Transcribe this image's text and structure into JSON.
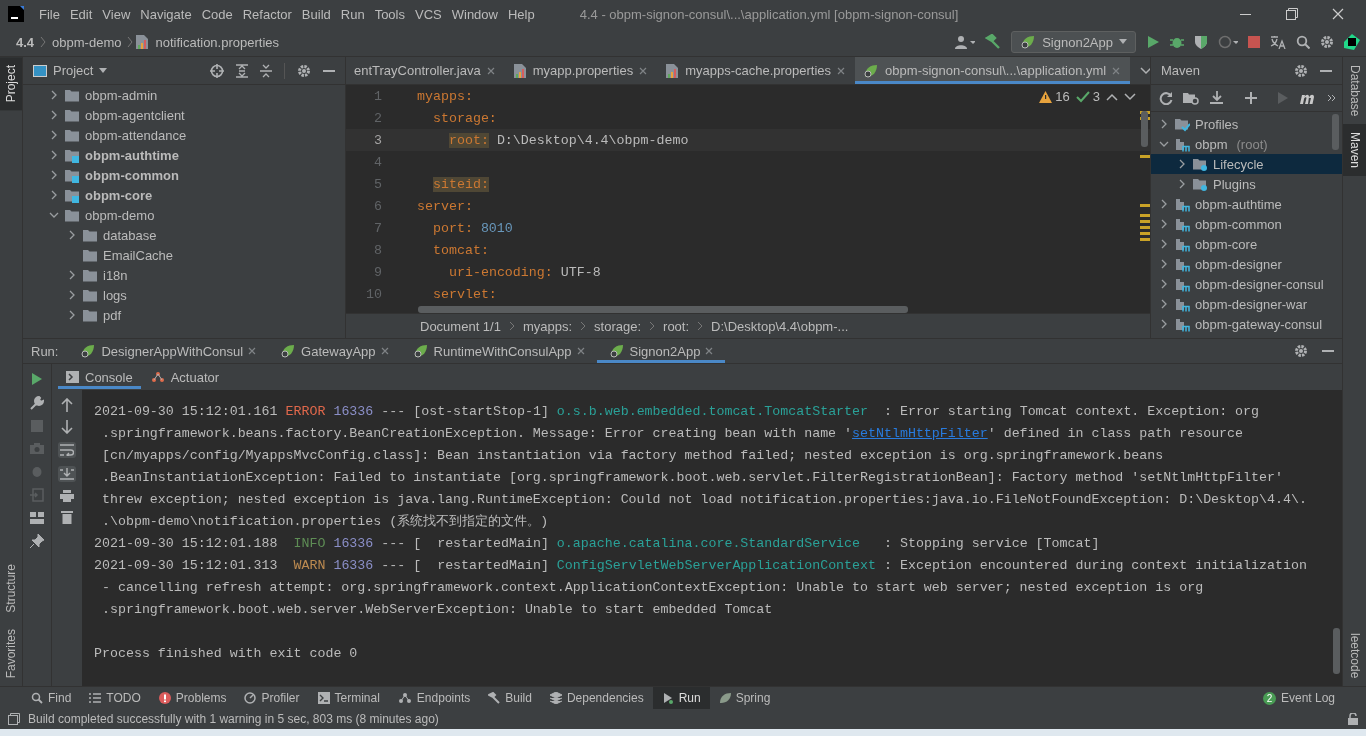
{
  "window": {
    "title": "4.4 - obpm-signon-consul\\...\\application.yml [obpm-signon-consul]"
  },
  "menu": [
    "File",
    "Edit",
    "View",
    "Navigate",
    "Code",
    "Refactor",
    "Build",
    "Run",
    "Tools",
    "VCS",
    "Window",
    "Help"
  ],
  "navbar": {
    "crumbs": [
      "4.4",
      "obpm-demo",
      "notification.properties"
    ],
    "run_config": "Signon2App"
  },
  "left_strip": {
    "top": [
      {
        "label": "Project",
        "selected": true
      }
    ],
    "bottom": [
      {
        "label": "Structure",
        "selected": false
      },
      {
        "label": "Favorites",
        "selected": false
      }
    ]
  },
  "right_strip": {
    "top": [
      {
        "label": "Database",
        "selected": false
      },
      {
        "label": "Maven",
        "selected": true
      }
    ],
    "bottom": [
      {
        "label": "leetcode",
        "selected": false
      }
    ]
  },
  "project": {
    "title": "Project",
    "items": [
      {
        "name": "obpm-admin",
        "module": false,
        "expanded": false
      },
      {
        "name": "obpm-agentclient",
        "module": false,
        "expanded": false
      },
      {
        "name": "obpm-attendance",
        "module": false,
        "expanded": false
      },
      {
        "name": "obpm-authtime",
        "module": true,
        "expanded": false
      },
      {
        "name": "obpm-common",
        "module": true,
        "expanded": false
      },
      {
        "name": "obpm-core",
        "module": true,
        "expanded": false
      },
      {
        "name": "obpm-demo",
        "module": false,
        "expanded": true,
        "children": [
          {
            "name": "database",
            "module": false,
            "expanded": false
          },
          {
            "name": "EmailCache",
            "module": false
          },
          {
            "name": "i18n",
            "module": false,
            "expanded": false
          },
          {
            "name": "logs",
            "module": false,
            "expanded": false
          },
          {
            "name": "pdf",
            "module": false,
            "expanded": false
          }
        ]
      }
    ]
  },
  "editor": {
    "tabs": [
      {
        "label": "entTrayController.java",
        "kind": "java",
        "selected": false
      },
      {
        "label": "myapp.properties",
        "kind": "properties",
        "selected": false
      },
      {
        "label": "myapps-cache.properties",
        "kind": "properties",
        "selected": false
      },
      {
        "label": "obpm-signon-consul\\...\\application.yml",
        "kind": "spring",
        "selected": true
      }
    ],
    "warnings": "16",
    "checks": "3",
    "lines": [
      {
        "num": "1",
        "key": "myapps:",
        "highlight": false,
        "current": false,
        "children": [
          {
            "num": "2",
            "key": "storage:",
            "highlight": false,
            "current": false,
            "children": [
              {
                "num": "3",
                "key": "root:",
                "highlight": true,
                "value": "D:\\Desktop\\4.4\\obpm-demo",
                "kind": "text",
                "current": true
              }
            ]
          },
          {
            "num": "4",
            "current": false
          },
          {
            "num": "5",
            "key": "siteid:",
            "highlight": true,
            "current": false
          }
        ]
      },
      {
        "num": "6",
        "key": "server:",
        "highlight": false,
        "current": false,
        "children": [
          {
            "num": "7",
            "key": "port:",
            "highlight": false,
            "value": "8010",
            "kind": "number",
            "current": false
          },
          {
            "num": "8",
            "key": "tomcat:",
            "highlight": false,
            "current": false,
            "children": [
              {
                "num": "9",
                "key": "uri-encoding:",
                "highlight": false,
                "value": "UTF-8",
                "kind": "text",
                "current": false
              }
            ]
          },
          {
            "num": "10",
            "key": "servlet:",
            "highlight": false,
            "current": false
          }
        ]
      }
    ],
    "breadcrumb": [
      "Document 1/1",
      "myapps:",
      "storage:",
      "root:",
      "D:\\Desktop\\4.4\\obpm-..."
    ]
  },
  "maven": {
    "title": "Maven",
    "items": [
      {
        "name": "Profiles",
        "kind": "profiles",
        "selected": false,
        "expanded": false
      },
      {
        "name": "obpm",
        "note": "(root)",
        "kind": "module",
        "selected": false,
        "expanded": true,
        "children": [
          {
            "name": "Lifecycle",
            "kind": "folder",
            "selected": true,
            "expanded": false
          },
          {
            "name": "Plugins",
            "kind": "folder",
            "selected": false,
            "expanded": false
          }
        ]
      },
      {
        "name": "obpm-authtime",
        "kind": "module",
        "selected": false,
        "expanded": false
      },
      {
        "name": "obpm-common",
        "kind": "module",
        "selected": false,
        "expanded": false
      },
      {
        "name": "obpm-core",
        "kind": "module",
        "selected": false,
        "expanded": false
      },
      {
        "name": "obpm-designer",
        "kind": "module",
        "selected": false,
        "expanded": false
      },
      {
        "name": "obpm-designer-consul",
        "kind": "module",
        "selected": false,
        "expanded": false
      },
      {
        "name": "obpm-designer-war",
        "kind": "module",
        "selected": false,
        "expanded": false
      },
      {
        "name": "obpm-gateway-consul",
        "kind": "module",
        "selected": false,
        "expanded": false
      }
    ]
  },
  "run": {
    "label": "Run:",
    "tabs": [
      {
        "label": "DesignerAppWithConsul",
        "selected": false
      },
      {
        "label": "GatewayApp",
        "selected": false
      },
      {
        "label": "RuntimeWithConsulApp",
        "selected": false
      },
      {
        "label": "Signon2App",
        "selected": true
      }
    ],
    "subtabs": [
      {
        "label": "Console",
        "kind": "console",
        "selected": true
      },
      {
        "label": "Actuator",
        "kind": "actuator",
        "selected": false
      }
    ],
    "soft_wrap": true,
    "scroll_to_end": true,
    "console": [
      {
        "kind": "log",
        "segs": [
          {
            "text": "2021-09-30 15:12:01.161 ",
            "kind": "plain"
          },
          {
            "text": "ERROR",
            "kind": "error"
          },
          {
            "text": " 16336",
            "kind": "pid"
          },
          {
            "text": " --- [ost-startStop-1] ",
            "kind": "plain"
          },
          {
            "text": "o.s.b.web.embedded.tomcat.TomcatStarter",
            "kind": "logger"
          },
          {
            "text": "  : Error starting Tomcat context. Exception: org",
            "kind": "plain"
          }
        ]
      },
      {
        "kind": "log",
        "segs": [
          {
            "text": " .springframework.beans.factory.BeanCreationException. Message: Error creating bean with name '",
            "kind": "plain"
          },
          {
            "text": "setNtlmHttpFilter",
            "kind": "link"
          },
          {
            "text": "' defined in class path resource",
            "kind": "plain"
          }
        ]
      },
      {
        "kind": "log",
        "segs": [
          {
            "text": " [cn/myapps/config/MyappsMvcConfig.class]: Bean instantiation via factory method failed; nested exception is org.springframework.beans",
            "kind": "plain"
          }
        ]
      },
      {
        "kind": "log",
        "segs": [
          {
            "text": " .BeanInstantiationException: Failed to instantiate [org.springframework.boot.web.servlet.FilterRegistrationBean]: Factory method 'setNtlmHttpFilter'",
            "kind": "plain"
          }
        ]
      },
      {
        "kind": "log",
        "segs": [
          {
            "text": " threw exception; nested exception is java.lang.RuntimeException: Could not load notification.properties:java.io.FileNotFoundException: D:\\Desktop\\4.4\\.",
            "kind": "plain"
          }
        ]
      },
      {
        "kind": "log",
        "segs": [
          {
            "text": " .\\obpm-demo\\notification.properties (系统找不到指定的文件。)",
            "kind": "plain"
          }
        ]
      },
      {
        "kind": "log",
        "segs": [
          {
            "text": "2021-09-30 15:12:01.188  ",
            "kind": "plain"
          },
          {
            "text": "INFO",
            "kind": "info"
          },
          {
            "text": " 16336",
            "kind": "pid"
          },
          {
            "text": " --- [  restartedMain] ",
            "kind": "plain"
          },
          {
            "text": "o.apache.catalina.core.StandardService",
            "kind": "logger"
          },
          {
            "text": "   : Stopping service [Tomcat]",
            "kind": "plain"
          }
        ]
      },
      {
        "kind": "log",
        "segs": [
          {
            "text": "2021-09-30 15:12:01.313  ",
            "kind": "plain"
          },
          {
            "text": "WARN",
            "kind": "warn"
          },
          {
            "text": " 16336",
            "kind": "pid"
          },
          {
            "text": " --- [  restartedMain] ",
            "kind": "plain"
          },
          {
            "text": "ConfigServletWebServerApplicationContext",
            "kind": "logger"
          },
          {
            "text": " : Exception encountered during context initialization",
            "kind": "plain"
          }
        ]
      },
      {
        "kind": "log",
        "segs": [
          {
            "text": " - cancelling refresh attempt: org.springframework.context.ApplicationContextException: Unable to start web server; nested exception is org",
            "kind": "plain"
          }
        ]
      },
      {
        "kind": "log",
        "segs": [
          {
            "text": " .springframework.boot.web.server.WebServerException: Unable to start embedded Tomcat",
            "kind": "plain"
          }
        ]
      },
      {
        "kind": "exit",
        "segs": [
          {
            "text": "Process finished with exit code 0",
            "kind": "plain"
          }
        ]
      }
    ]
  },
  "tool_windows": [
    {
      "label": "Find",
      "kind": "search",
      "selected": false
    },
    {
      "label": "TODO",
      "kind": "list",
      "selected": false
    },
    {
      "label": "Problems",
      "kind": "error",
      "selected": false
    },
    {
      "label": "Profiler",
      "kind": "profiler",
      "selected": false
    },
    {
      "label": "Terminal",
      "kind": "terminal",
      "selected": false
    },
    {
      "label": "Endpoints",
      "kind": "endpoints",
      "selected": false
    },
    {
      "label": "Build",
      "kind": "hammer",
      "selected": false
    },
    {
      "label": "Dependencies",
      "kind": "layers",
      "selected": false
    },
    {
      "label": "Run",
      "kind": "run",
      "selected": true
    },
    {
      "label": "Spring",
      "kind": "leaf",
      "selected": false
    }
  ],
  "event_log": {
    "label": "Event Log",
    "count": "2"
  },
  "status_bar": {
    "message": "Build completed successfully with 1 warning in 5 sec, 803 ms (8 minutes ago)"
  }
}
